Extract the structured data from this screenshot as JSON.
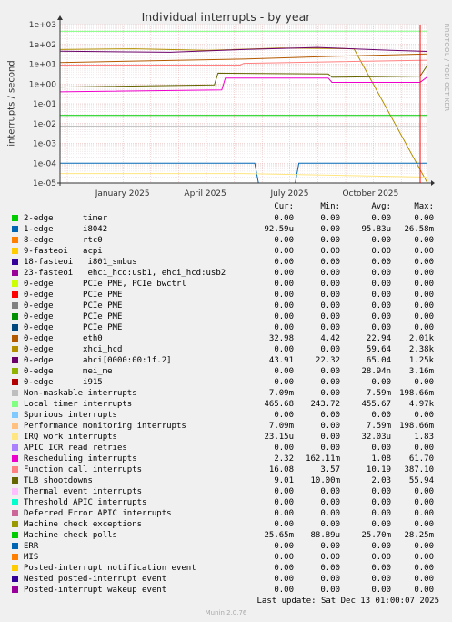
{
  "title": "Individual interrupts - by year",
  "ylabel": "interrupts / second",
  "side_text": "RRDTOOL / TOBI OETIKER",
  "footer": {
    "last_update": "Last update: Sat Dec 13 01:00:07 2025",
    "munin": "Munin 2.0.76"
  },
  "legend_header": {
    "cur": "Cur:",
    "min": "Min:",
    "avg": "Avg:",
    "max": "Max:"
  },
  "legend": [
    {
      "label": "2-edge      timer",
      "color": "#00cc00",
      "cur": "0.00",
      "min": "0.00",
      "avg": "0.00",
      "max": "0.00"
    },
    {
      "label": "1-edge      i8042",
      "color": "#0066b3",
      "cur": "92.59u",
      "min": "0.00",
      "avg": "95.83u",
      "max": "26.58m"
    },
    {
      "label": "8-edge      rtc0",
      "color": "#ff8000",
      "cur": "0.00",
      "min": "0.00",
      "avg": "0.00",
      "max": "0.00"
    },
    {
      "label": "9-fasteoi   acpi",
      "color": "#ffcc00",
      "cur": "0.00",
      "min": "0.00",
      "avg": "0.00",
      "max": "0.00"
    },
    {
      "label": "18-fasteoi   i801_smbus",
      "color": "#330099",
      "cur": "0.00",
      "min": "0.00",
      "avg": "0.00",
      "max": "0.00"
    },
    {
      "label": "23-fasteoi   ehci_hcd:usb1, ehci_hcd:usb2",
      "color": "#990099",
      "cur": "0.00",
      "min": "0.00",
      "avg": "0.00",
      "max": "0.00"
    },
    {
      "label": "0-edge      PCIe PME, PCIe bwctrl",
      "color": "#ccff00",
      "cur": "0.00",
      "min": "0.00",
      "avg": "0.00",
      "max": "0.00"
    },
    {
      "label": "0-edge      PCIe PME",
      "color": "#ff0000",
      "cur": "0.00",
      "min": "0.00",
      "avg": "0.00",
      "max": "0.00"
    },
    {
      "label": "0-edge      PCIe PME",
      "color": "#808080",
      "cur": "0.00",
      "min": "0.00",
      "avg": "0.00",
      "max": "0.00"
    },
    {
      "label": "0-edge      PCIe PME",
      "color": "#008f00",
      "cur": "0.00",
      "min": "0.00",
      "avg": "0.00",
      "max": "0.00"
    },
    {
      "label": "0-edge      PCIe PME",
      "color": "#00487d",
      "cur": "0.00",
      "min": "0.00",
      "avg": "0.00",
      "max": "0.00"
    },
    {
      "label": "0-edge      eth0",
      "color": "#b35a00",
      "cur": "32.98",
      "min": "4.42",
      "avg": "22.94",
      "max": "2.01k"
    },
    {
      "label": "0-edge      xhci_hcd",
      "color": "#b38f00",
      "cur": "0.00",
      "min": "0.00",
      "avg": "59.64",
      "max": "2.38k"
    },
    {
      "label": "0-edge      ahci[0000:00:1f.2]",
      "color": "#6b006b",
      "cur": "43.91",
      "min": "22.32",
      "avg": "65.04",
      "max": "1.25k"
    },
    {
      "label": "0-edge      mei_me",
      "color": "#8fb300",
      "cur": "0.00",
      "min": "0.00",
      "avg": "28.94n",
      "max": "3.16m"
    },
    {
      "label": "0-edge      i915",
      "color": "#b30000",
      "cur": "0.00",
      "min": "0.00",
      "avg": "0.00",
      "max": "0.00"
    },
    {
      "label": "Non-maskable interrupts",
      "color": "#bebebe",
      "cur": "7.09m",
      "min": "0.00",
      "avg": "7.59m",
      "max": "198.66m"
    },
    {
      "label": "Local timer interrupts",
      "color": "#80ff80",
      "cur": "465.68",
      "min": "243.72",
      "avg": "455.67",
      "max": "4.97k"
    },
    {
      "label": "Spurious interrupts",
      "color": "#80c9ff",
      "cur": "0.00",
      "min": "0.00",
      "avg": "0.00",
      "max": "0.00"
    },
    {
      "label": "Performance monitoring interrupts",
      "color": "#ffc080",
      "cur": "7.09m",
      "min": "0.00",
      "avg": "7.59m",
      "max": "198.66m"
    },
    {
      "label": "IRQ work interrupts",
      "color": "#ffe680",
      "cur": "23.15u",
      "min": "0.00",
      "avg": "32.03u",
      "max": "1.83"
    },
    {
      "label": "APIC ICR read retries",
      "color": "#aa80ff",
      "cur": "0.00",
      "min": "0.00",
      "avg": "0.00",
      "max": "0.00"
    },
    {
      "label": "Rescheduling interrupts",
      "color": "#ee00cc",
      "cur": "2.32",
      "min": "162.11m",
      "avg": "1.08",
      "max": "61.70"
    },
    {
      "label": "Function call interrupts",
      "color": "#ff8080",
      "cur": "16.08",
      "min": "3.57",
      "avg": "10.19",
      "max": "387.10"
    },
    {
      "label": "TLB shootdowns",
      "color": "#666600",
      "cur": "9.01",
      "min": "10.00m",
      "avg": "2.03",
      "max": "55.94"
    },
    {
      "label": "Thermal event interrupts",
      "color": "#ffbfff",
      "cur": "0.00",
      "min": "0.00",
      "avg": "0.00",
      "max": "0.00"
    },
    {
      "label": "Threshold APIC interrupts",
      "color": "#00ffcc",
      "cur": "0.00",
      "min": "0.00",
      "avg": "0.00",
      "max": "0.00"
    },
    {
      "label": "Deferred Error APIC interrupts",
      "color": "#cc6699",
      "cur": "0.00",
      "min": "0.00",
      "avg": "0.00",
      "max": "0.00"
    },
    {
      "label": "Machine check exceptions",
      "color": "#999900",
      "cur": "0.00",
      "min": "0.00",
      "avg": "0.00",
      "max": "0.00"
    },
    {
      "label": "Machine check polls",
      "color": "#00cc00",
      "cur": "25.65m",
      "min": "88.89u",
      "avg": "25.70m",
      "max": "28.25m"
    },
    {
      "label": "ERR",
      "color": "#0066b3",
      "cur": "0.00",
      "min": "0.00",
      "avg": "0.00",
      "max": "0.00"
    },
    {
      "label": "MIS",
      "color": "#ff8000",
      "cur": "0.00",
      "min": "0.00",
      "avg": "0.00",
      "max": "0.00"
    },
    {
      "label": "Posted-interrupt notification event",
      "color": "#ffcc00",
      "cur": "0.00",
      "min": "0.00",
      "avg": "0.00",
      "max": "0.00"
    },
    {
      "label": "Nested posted-interrupt event",
      "color": "#330099",
      "cur": "0.00",
      "min": "0.00",
      "avg": "0.00",
      "max": "0.00"
    },
    {
      "label": "Posted-interrupt wakeup event",
      "color": "#990099",
      "cur": "0.00",
      "min": "0.00",
      "avg": "0.00",
      "max": "0.00"
    }
  ],
  "chart_data": {
    "type": "line",
    "title": "Individual interrupts - by year",
    "ylabel": "interrupts / second",
    "y_scale": "log",
    "ylim": [
      1e-05,
      1000
    ],
    "y_ticks": [
      "1e-05",
      "1e-04",
      "1e-03",
      "1e-02",
      "1e-01",
      "1e+00",
      "1e+01",
      "1e+02",
      "1e+03"
    ],
    "x_ticks": [
      "January 2025",
      "April 2025",
      "July 2025",
      "October 2025"
    ],
    "grid": true,
    "series": [
      {
        "name": "Local timer interrupts",
        "color": "#80ff80",
        "points": [
          [
            0,
            455
          ],
          [
            0.49,
            455
          ],
          [
            0.5,
            460
          ],
          [
            1,
            465
          ]
        ]
      },
      {
        "name": "0-edge      xhci_hcd",
        "color": "#b38f00",
        "points": [
          [
            0,
            55
          ],
          [
            0.2,
            60
          ],
          [
            0.4,
            50
          ],
          [
            0.6,
            65
          ],
          [
            0.8,
            60
          ],
          [
            1,
            1e-05
          ]
        ]
      },
      {
        "name": "0-edge      ahci[0000:00:1f.2]",
        "color": "#6b006b",
        "points": [
          [
            0,
            45
          ],
          [
            0.3,
            40
          ],
          [
            0.5,
            55
          ],
          [
            0.7,
            70
          ],
          [
            0.9,
            50
          ],
          [
            1,
            43.91
          ]
        ]
      },
      {
        "name": "0-edge      eth0",
        "color": "#b35a00",
        "points": [
          [
            0,
            12
          ],
          [
            0.25,
            15
          ],
          [
            0.5,
            18
          ],
          [
            0.75,
            25
          ],
          [
            1,
            32.98
          ]
        ]
      },
      {
        "name": "Function call interrupts",
        "color": "#ff8080",
        "points": [
          [
            0,
            9
          ],
          [
            0.49,
            9
          ],
          [
            0.5,
            11
          ],
          [
            1,
            16
          ]
        ]
      },
      {
        "name": "TLB shootdowns",
        "color": "#666600",
        "points": [
          [
            0,
            0.7
          ],
          [
            0.42,
            0.9
          ],
          [
            0.43,
            3.5
          ],
          [
            0.73,
            3.2
          ],
          [
            0.74,
            2.2
          ],
          [
            0.98,
            2.5
          ],
          [
            1,
            9.01
          ]
        ]
      },
      {
        "name": "Rescheduling interrupts",
        "color": "#ee00cc",
        "points": [
          [
            0,
            0.4
          ],
          [
            0.44,
            0.5
          ],
          [
            0.45,
            2
          ],
          [
            0.73,
            2
          ],
          [
            0.74,
            1.2
          ],
          [
            0.98,
            1.2
          ],
          [
            1,
            2.32
          ]
        ]
      },
      {
        "name": "Machine check polls",
        "color": "#00cc00",
        "points": [
          [
            0,
            0.0257
          ],
          [
            1,
            0.0257
          ]
        ]
      },
      {
        "name": "Non-maskable interrupts",
        "color": "#bebebe",
        "points": [
          [
            0,
            0.0075
          ],
          [
            1,
            0.0071
          ]
        ]
      },
      {
        "name": "1-edge      i8042",
        "color": "#0066b3",
        "points": [
          [
            0,
            0.0001
          ],
          [
            0.53,
            0.0001
          ],
          [
            0.54,
            1e-05
          ],
          [
            0.64,
            1e-05
          ],
          [
            0.65,
            0.0001
          ],
          [
            1,
            0.0001
          ]
        ]
      },
      {
        "name": "IRQ work interrupts",
        "color": "#ffe680",
        "points": [
          [
            0,
            3e-05
          ],
          [
            0.5,
            3e-05
          ],
          [
            1,
            2e-05
          ]
        ]
      }
    ]
  }
}
